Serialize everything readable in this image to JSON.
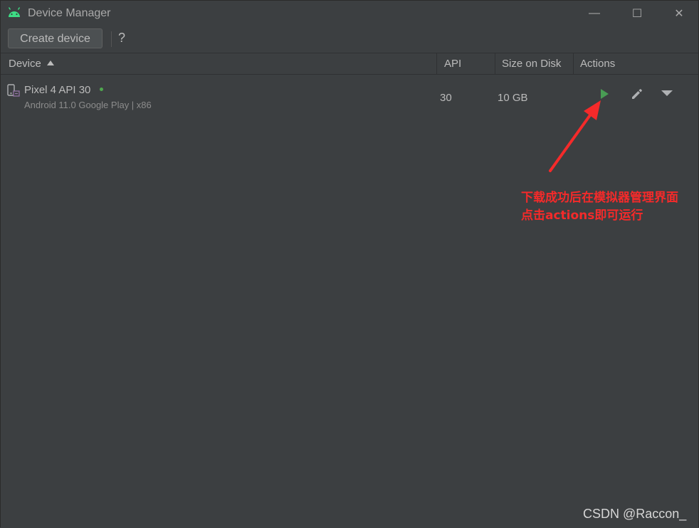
{
  "window": {
    "title": "Device Manager",
    "app_icon": "android-icon",
    "controls": {
      "minimize": "—",
      "maximize": "☐",
      "close": "✕"
    }
  },
  "toolbar": {
    "create_label": "Create device",
    "help_label": "?"
  },
  "table": {
    "columns": [
      {
        "label": "Device",
        "sort": "ascending"
      },
      {
        "label": "API"
      },
      {
        "label": "Size on Disk"
      },
      {
        "label": "Actions"
      }
    ],
    "rows": [
      {
        "name": "Pixel 4 API 30",
        "status": "online",
        "description": "Android 11.0 Google Play | x86",
        "api": "30",
        "size": "10 GB",
        "actions": [
          "play-icon",
          "pencil-icon",
          "caret-down-icon"
        ]
      }
    ]
  },
  "annotation": {
    "text": "下载成功后在模拟器管理界面\n点击actions即可运行",
    "color": "#f52a2a"
  },
  "watermark": "CSDN @Raccon_",
  "colors": {
    "background": "#3c3f41",
    "text": "#bbbbbb",
    "android_green": "#3ddc84",
    "run_green": "#499c54",
    "annotation_red": "#f52a2a"
  }
}
